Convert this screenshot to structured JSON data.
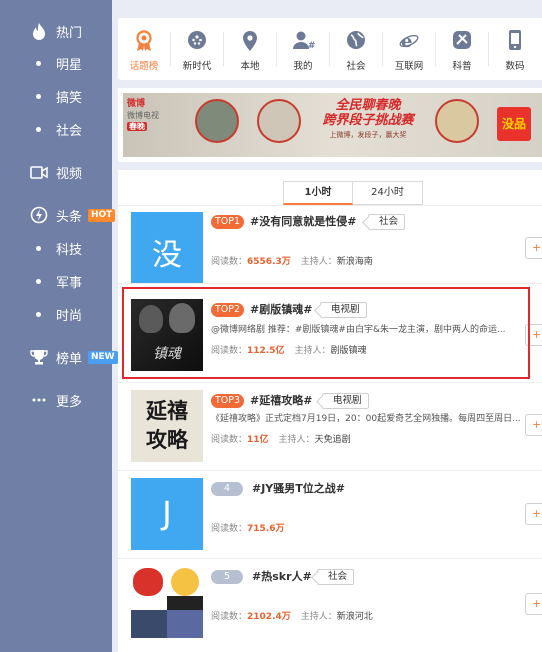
{
  "sidebar": {
    "items": [
      {
        "label": "热门",
        "kind": "main",
        "icon": "flame-icon"
      },
      {
        "label": "明星",
        "kind": "sub"
      },
      {
        "label": "搞笑",
        "kind": "sub"
      },
      {
        "label": "社会",
        "kind": "sub"
      },
      {
        "label": "视频",
        "kind": "main",
        "icon": "video-camera-icon"
      },
      {
        "label": "头条",
        "kind": "main",
        "icon": "lightning-icon",
        "badge": "HOT"
      },
      {
        "label": "科技",
        "kind": "sub"
      },
      {
        "label": "军事",
        "kind": "sub"
      },
      {
        "label": "时尚",
        "kind": "sub"
      },
      {
        "label": "榜单",
        "kind": "main",
        "icon": "trophy-icon",
        "badge": "NEW"
      },
      {
        "label": "更多",
        "kind": "main",
        "icon": "ellipsis-icon"
      }
    ]
  },
  "categories": [
    {
      "label": "话题榜",
      "icon": "medal-icon",
      "active": true
    },
    {
      "label": "新时代",
      "icon": "emblem-icon"
    },
    {
      "label": "本地",
      "icon": "location-pin-icon"
    },
    {
      "label": "我的",
      "icon": "user-hash-icon"
    },
    {
      "label": "社会",
      "icon": "globe-icon"
    },
    {
      "label": "互联网",
      "icon": "ie-browser-icon"
    },
    {
      "label": "科普",
      "icon": "satellite-icon"
    },
    {
      "label": "数码",
      "icon": "phone-icon"
    }
  ],
  "banner": {
    "logo_weibo": "微博",
    "logo_tv": "微博电视",
    "spring": "春晚",
    "title_line1": "全民聊春晚",
    "title_line2": "跨界段子挑战赛",
    "title_small": "上微博，发段子，赢大奖",
    "corner_logo": "没品"
  },
  "tabs": [
    {
      "label": "1小时",
      "active": true
    },
    {
      "label": "24小时",
      "active": false
    }
  ],
  "topics": [
    {
      "rank": "TOP1",
      "rank_style": "top",
      "title": "#没有同意就是性侵#",
      "tag": "社会",
      "description": "",
      "reads_label": "阅读数：",
      "reads": "6556.3万",
      "host_label": "主持人：",
      "host": "新浪海南",
      "thumb_text": "没",
      "thumb_color": "#3fa8f1"
    },
    {
      "rank": "TOP2",
      "rank_style": "top",
      "title": "#剧版镇魂#",
      "tag": "电视剧",
      "description": "@微博网络剧 推荐：#剧版镇魂#由白宇&朱一龙主演，剧中两人的命运...",
      "reads_label": "阅读数：",
      "reads": "112.5亿",
      "host_label": "主持人：",
      "host": "剧版镇魂",
      "thumb_text": "镇魂",
      "thumb_color": "#1a1a1a"
    },
    {
      "rank": "TOP3",
      "rank_style": "top",
      "title": "#延禧攻略#",
      "tag": "电视剧",
      "description": "《延禧攻略》正式定档7月19日，20：00起爱奇艺全网独播。每周四至周日...",
      "reads_label": "阅读数：",
      "reads": "11亿",
      "host_label": "主持人：",
      "host": "天免追剧",
      "thumb_text": "延禧攻略",
      "thumb_color": "#e9e4d8"
    },
    {
      "rank": "4",
      "rank_style": "plain",
      "title": "#JY骚男T位之战#",
      "tag": "",
      "description": "",
      "reads_label": "阅读数：",
      "reads": "715.6万",
      "host_label": "",
      "host": "",
      "thumb_text": "J",
      "thumb_color": "#3fa8f1"
    },
    {
      "rank": "5",
      "rank_style": "plain",
      "title": "#热skr人#",
      "tag": "社会",
      "description": "",
      "reads_label": "阅读数：",
      "reads": "2102.4万",
      "host_label": "主持人：",
      "host": "新浪河北",
      "thumb_text": "",
      "thumb_color": "#ffffff"
    }
  ]
}
